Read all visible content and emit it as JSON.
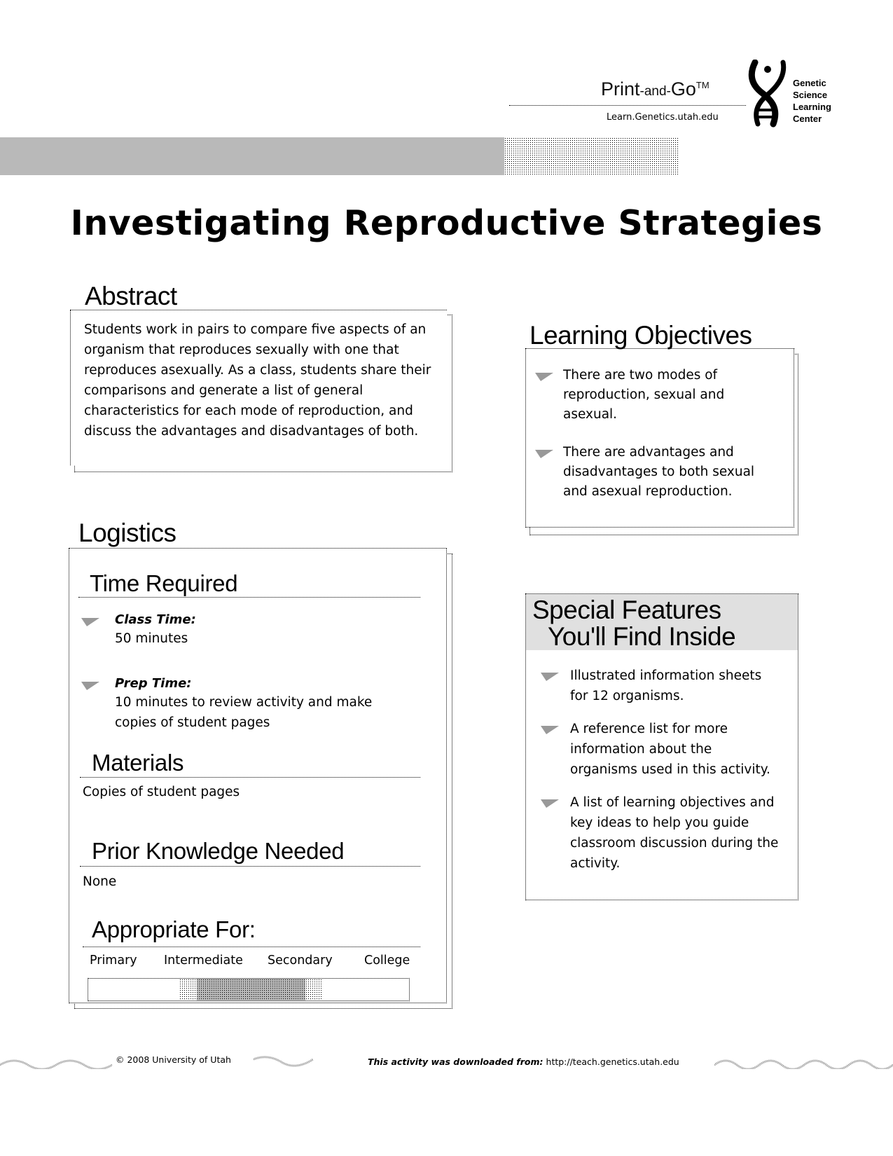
{
  "header": {
    "brand_main": "Print",
    "brand_mid": "-and-",
    "brand_end": "Go",
    "trademark": "TM",
    "url": "Learn.Genetics.utah.edu",
    "logo_icon": "dna-figure-icon",
    "org_lines": [
      "Genetic",
      "Science",
      "Learning",
      "Center"
    ]
  },
  "title": "Investigating Reproductive Strategies",
  "abstract": {
    "heading": "Abstract",
    "text": "Students work in pairs to compare five aspects of an organism that reproduces sexually with one that reproduces asexually.  As a class, students share their comparisons and generate a list of general characteristics for each mode of reproduction, and discuss the advantages and disadvantages of both."
  },
  "learning_objectives": {
    "heading": "Learning Objectives",
    "items": [
      "There are two modes of reproduction, sexual and asexual.",
      "There are advantages and disadvantages to both sexual and asexual reproduction."
    ]
  },
  "logistics": {
    "heading": "Logistics",
    "time_required": {
      "heading": "Time Required",
      "items": [
        {
          "label": "Class Time:",
          "value": "50 minutes"
        },
        {
          "label": "Prep Time:",
          "value": "10 minutes to review activity and make copies of student pages"
        }
      ]
    },
    "materials": {
      "heading": "Materials",
      "text": "Copies of student pages"
    },
    "prior_knowledge": {
      "heading": "Prior Knowledge Needed",
      "text": "None"
    },
    "appropriate_for": {
      "heading": "Appropriate For:",
      "levels": [
        "Primary",
        "Intermediate",
        "Secondary",
        "College"
      ],
      "highlighted_levels": [
        "Intermediate",
        "Secondary"
      ]
    }
  },
  "special_features": {
    "heading_line1": "Special Features",
    "heading_line2": "You'll Find Inside",
    "items": [
      "Illustrated information sheets for 12 organisms.",
      "A reference list for more information about the organisms used in this activity.",
      "A list of learning objectives and key ideas to help you guide classroom discussion during the activity."
    ]
  },
  "footer": {
    "copyright": "© 2008 University of Utah",
    "download_label": "This activity was downloaded from:",
    "download_url": "http://teach.genetics.utah.edu"
  }
}
